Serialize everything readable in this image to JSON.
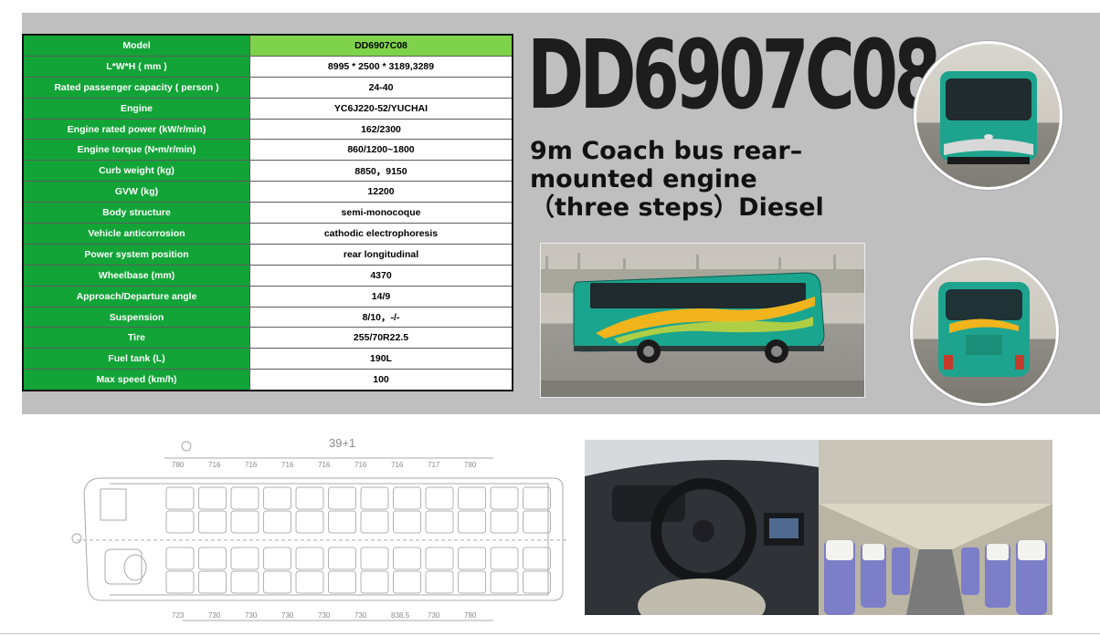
{
  "title": "DD6907C08",
  "subtitle_lines": [
    "9m Coach bus rear–",
    "mounted engine",
    "（three steps）Diesel"
  ],
  "specs": [
    {
      "label": "Model",
      "value": "DD6907C08"
    },
    {
      "label": "L*W*H ( mm )",
      "value": "8995 * 2500 * 3189,3289"
    },
    {
      "label": "Rated passenger capacity ( person )",
      "value": "24-40"
    },
    {
      "label": "Engine",
      "value": "YC6J220-52/YUCHAI"
    },
    {
      "label": "Engine rated power (kW/r/min)",
      "value": "162/2300"
    },
    {
      "label": "Engine torque (N•m/r/min)",
      "value": "860/1200~1800"
    },
    {
      "label": "Curb weight (kg)",
      "value": "8850，9150"
    },
    {
      "label": "GVW (kg)",
      "value": "12200"
    },
    {
      "label": "Body structure",
      "value": "semi-monocoque"
    },
    {
      "label": "Vehicle anticorrosion",
      "value": "cathodic electrophoresis"
    },
    {
      "label": "Power system position",
      "value": "rear longitudinal"
    },
    {
      "label": "Wheelbase (mm)",
      "value": "4370"
    },
    {
      "label": "Approach/Departure angle",
      "value": "14/9"
    },
    {
      "label": "Suspension",
      "value": "8/10，-/-"
    },
    {
      "label": "Tire",
      "value": "255/70R22.5"
    },
    {
      "label": "Fuel tank (L)",
      "value": "190L"
    },
    {
      "label": "Max speed (km/h)",
      "value": "100"
    }
  ],
  "floorplan": {
    "seat_label": "39+1",
    "top_dims": [
      "780",
      "716",
      "716",
      "716",
      "716",
      "716",
      "716",
      "717",
      "780"
    ],
    "bottom_dims": [
      "723",
      "730",
      "730",
      "730",
      "730",
      "730",
      "838.5",
      "730",
      "780"
    ]
  },
  "colors": {
    "spec_green": "#12a437",
    "model_green": "#7ed34a",
    "bus_teal": "#1aa58e"
  }
}
